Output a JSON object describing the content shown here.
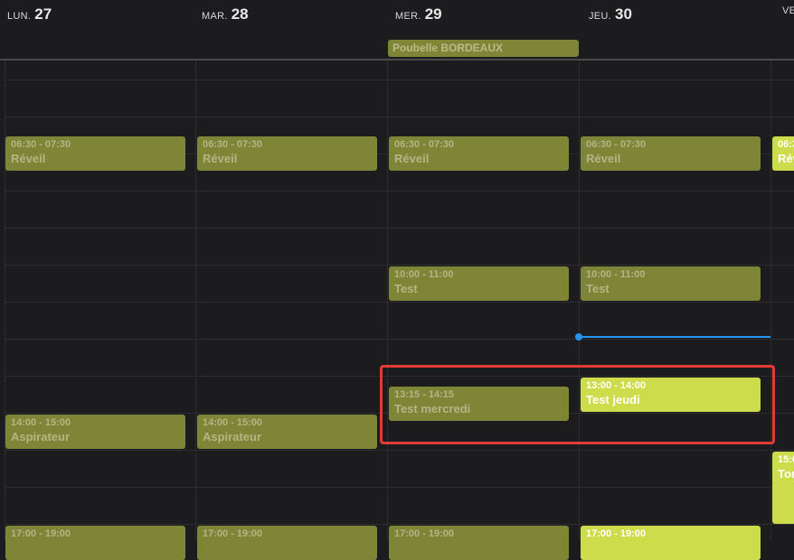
{
  "days": [
    {
      "name": "LUN.",
      "num": "27"
    },
    {
      "name": "MAR.",
      "num": "28"
    },
    {
      "name": "MER.",
      "num": "29"
    },
    {
      "name": "JEU.",
      "num": "30"
    },
    {
      "name": "VE",
      "num": ""
    }
  ],
  "allday_events": [
    {
      "title": "Poubelle BORDEAUX"
    }
  ],
  "events": {
    "reveil_mon": {
      "time": "06:30 - 07:30",
      "title": "Réveil"
    },
    "reveil_tue": {
      "time": "06:30 - 07:30",
      "title": "Réveil"
    },
    "reveil_wed": {
      "time": "06:30 - 07:30",
      "title": "Réveil"
    },
    "reveil_thu": {
      "time": "06:30 - 07:30",
      "title": "Réveil"
    },
    "reveil_fri": {
      "time": "06:3",
      "title": "Rév"
    },
    "test_wed": {
      "time": "10:00 - 11:00",
      "title": "Test"
    },
    "test_thu": {
      "time": "10:00 - 11:00",
      "title": "Test"
    },
    "test_mercredi": {
      "time": "13:15 - 14:15",
      "title": "Test mercredi"
    },
    "test_jeudi": {
      "time": "13:00 - 14:00",
      "title": "Test jeudi"
    },
    "aspirateur_mon": {
      "time": "14:00 - 15:00",
      "title": "Aspirateur"
    },
    "aspirateur_tue": {
      "time": "14:00 - 15:00",
      "title": "Aspirateur"
    },
    "fri_1500": {
      "time": "15:0",
      "title": "Ton"
    },
    "evening_mon": {
      "time": "17:00 - 19:00",
      "title": ""
    },
    "evening_tue": {
      "time": "17:00 - 19:00",
      "title": ""
    },
    "evening_wed": {
      "time": "17:00 - 19:00",
      "title": ""
    },
    "evening_thu": {
      "time": "17:00 - 19:00",
      "title": ""
    }
  },
  "colors": {
    "background": "#1c1c1e",
    "past_event": "#7f8537",
    "future_event": "#cddc4a",
    "now_indicator": "#2196f3",
    "highlight_box": "#e53935"
  }
}
